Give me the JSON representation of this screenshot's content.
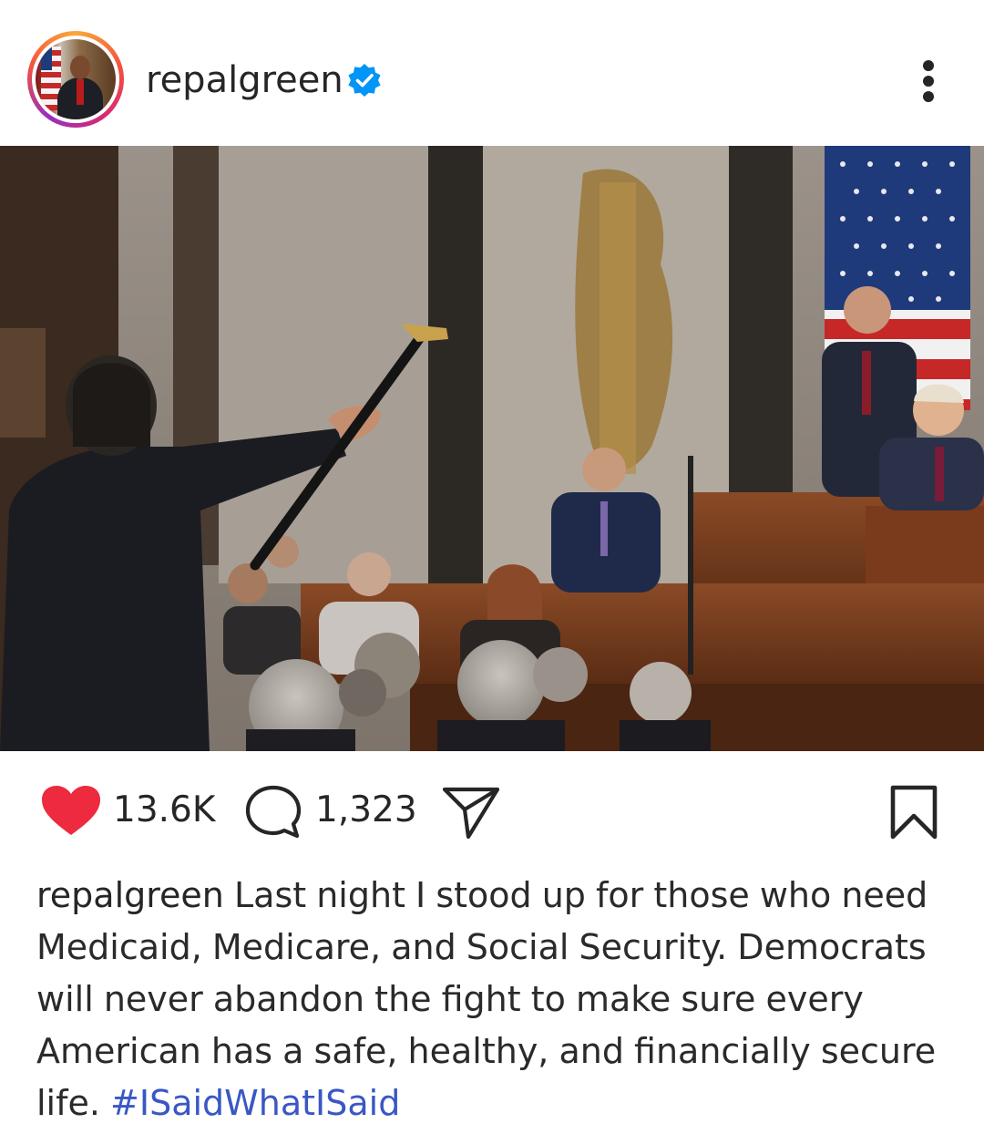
{
  "post": {
    "username": "repalgreen",
    "verified": true,
    "likes": "13.6K",
    "comments": "1,323",
    "caption_user": "repalgreen",
    "caption_text": "Last night I stood up for those who need Medicaid, Medicare, and Social Security. Democrats will never abandon the fight to make sure every American has a safe, healthy, and financially secure life.",
    "hashtag": "#ISaidWhatISaid"
  },
  "icons": {
    "like": "heart-icon",
    "comment": "comment-bubble-icon",
    "share": "paper-plane-icon",
    "save": "bookmark-icon",
    "more": "more-vertical-icon",
    "verified": "verified-badge-icon"
  },
  "colors": {
    "heart": "#ed2a3e",
    "verified": "#0095f6",
    "hashtag": "#3a57c4",
    "text": "#262626"
  }
}
